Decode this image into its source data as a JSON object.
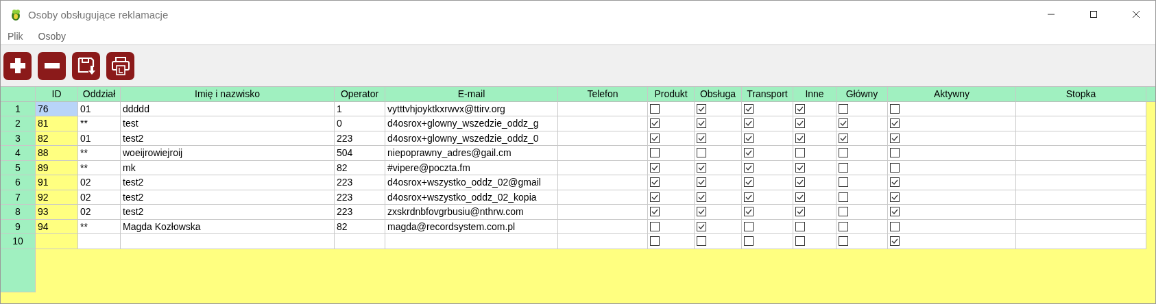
{
  "window": {
    "title": "Osoby obsługujące reklamacje"
  },
  "menu": [
    "Plik",
    "Osoby"
  ],
  "toolbar": [
    {
      "kind": "add"
    },
    {
      "kind": "remove"
    },
    {
      "kind": "save"
    },
    {
      "kind": "print"
    }
  ],
  "table": {
    "columns": [
      "ID",
      "Oddział",
      "Imię i nazwisko",
      "Operator",
      "E-mail",
      "Telefon",
      "Produkt",
      "Obsługa",
      "Transport",
      "Inne",
      "Główny",
      "Aktywny",
      "Stopka"
    ],
    "rows": [
      {
        "number": "1",
        "id": "76",
        "branch": "01",
        "name": "ddddd",
        "operator": "1",
        "email": "vytttvhjoyktkxrwvx@ttirv.org",
        "selected": true,
        "checks": [
          false,
          true,
          true,
          true,
          false,
          false
        ]
      },
      {
        "number": "2",
        "id": "81",
        "branch": "**",
        "name": "test",
        "operator": "0",
        "email": "d4osrox+glowny_wszedzie_oddz_g",
        "selected": false,
        "checks": [
          true,
          true,
          true,
          true,
          true,
          true
        ]
      },
      {
        "number": "3",
        "id": "82",
        "branch": "01",
        "name": "test2",
        "operator": "223",
        "email": "d4osrox+glowny_wszedzie_oddz_0",
        "selected": false,
        "checks": [
          true,
          true,
          true,
          true,
          true,
          true
        ]
      },
      {
        "number": "4",
        "id": "88",
        "branch": "**",
        "name": "woeijrowiejroij",
        "operator": "504",
        "email": "niepoprawny_adres@gail.cm",
        "selected": false,
        "checks": [
          false,
          false,
          true,
          false,
          false,
          false
        ]
      },
      {
        "number": "5",
        "id": "89",
        "branch": "**",
        "name": "mk",
        "operator": "82",
        "email": "#vipere@poczta.fm",
        "selected": false,
        "checks": [
          true,
          true,
          true,
          true,
          false,
          false
        ]
      },
      {
        "number": "6",
        "id": "91",
        "branch": "02",
        "name": "test2",
        "operator": "223",
        "email": "d4osrox+wszystko_oddz_02@gmail",
        "selected": false,
        "checks": [
          true,
          true,
          true,
          true,
          false,
          true
        ]
      },
      {
        "number": "7",
        "id": "92",
        "branch": "02",
        "name": "test2",
        "operator": "223",
        "email": "d4osrox+wszystko_oddz_02_kopia",
        "selected": false,
        "checks": [
          true,
          true,
          true,
          true,
          false,
          true
        ]
      },
      {
        "number": "8",
        "id": "93",
        "branch": "02",
        "name": "test2",
        "operator": "223",
        "email": "zxskrdnbfovgrbusiu@nthrw.com",
        "selected": false,
        "checks": [
          true,
          true,
          true,
          true,
          false,
          true
        ]
      },
      {
        "number": "9",
        "id": "94",
        "branch": "**",
        "name": "Magda Kozłowska",
        "operator": "82",
        "email": "magda@recordsystem.com.pl",
        "selected": false,
        "checks": [
          false,
          true,
          false,
          false,
          false,
          false
        ]
      },
      {
        "number": "10",
        "selected": false,
        "checks": [
          false,
          false,
          false,
          false,
          false,
          true
        ]
      }
    ]
  }
}
